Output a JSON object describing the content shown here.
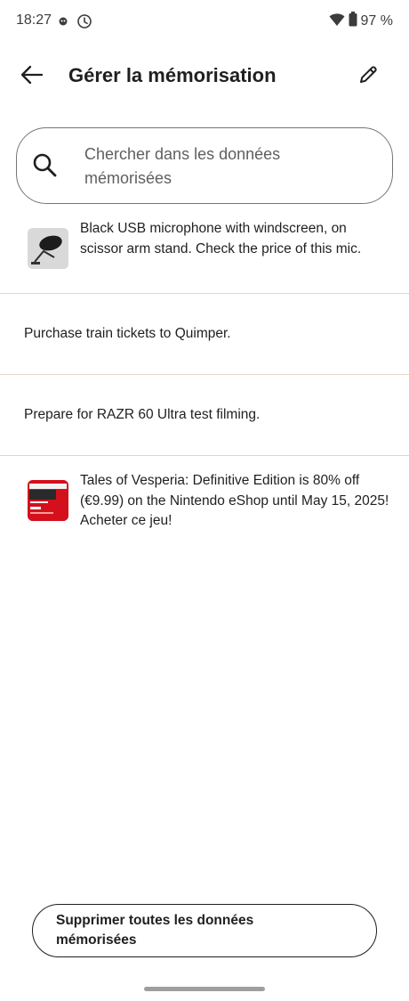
{
  "status_bar": {
    "time": "18:27",
    "battery": "97 %",
    "icons": [
      "notification-icon",
      "clock-icon",
      "wifi-icon",
      "battery-icon"
    ]
  },
  "app_bar": {
    "title": "Gérer la mémorisation",
    "back_icon": "arrow-left-icon",
    "edit_icon": "pencil-icon"
  },
  "search": {
    "placeholder": "Chercher dans les données mémorisées"
  },
  "memories": [
    {
      "text": "Black USB microphone with windscreen, on scissor arm stand.  Check the price of this mic.",
      "thumbnail": "microphone-photo"
    },
    {
      "text": "Purchase train tickets to Quimper."
    },
    {
      "text": "Prepare for RAZR 60 Ultra test filming."
    },
    {
      "text": "Tales of Vesperia: Definitive Edition is 80% off (€9.99) on the Nintendo eShop until May 15, 2025!  Acheter ce jeu!",
      "thumbnail": "eshop-screenshot"
    }
  ],
  "footer": {
    "delete_all_label": "Supprimer toutes les données mémorisées"
  },
  "colors": {
    "divider": "#e6d3c6",
    "eshop_red": "#d4101c"
  }
}
